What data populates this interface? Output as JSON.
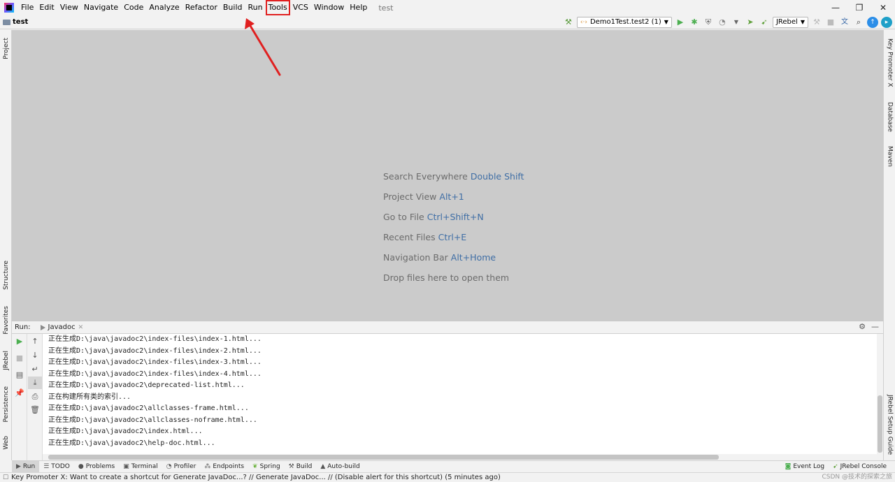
{
  "menu": {
    "items": [
      "File",
      "Edit",
      "View",
      "Navigate",
      "Code",
      "Analyze",
      "Refactor",
      "Build",
      "Run",
      "Tools",
      "VCS",
      "Window",
      "Help"
    ],
    "project_title": "test"
  },
  "window_controls": {
    "minimize": "—",
    "restore": "❐",
    "close": "✕"
  },
  "navbar": {
    "project": "test",
    "run_config": "Demo1Test.test2 (1)",
    "jrebel": "JRebel"
  },
  "left_tabs": [
    "Project",
    "Structure",
    "Favorites",
    "JRebel",
    "Persistence",
    "Web"
  ],
  "right_tabs": [
    "Key Promoter X",
    "Database",
    "Maven",
    "JRebel Setup Guide"
  ],
  "editor_hints": [
    {
      "text": "Search Everywhere",
      "shortcut": "Double Shift"
    },
    {
      "text": "Project View",
      "shortcut": "Alt+1"
    },
    {
      "text": "Go to File",
      "shortcut": "Ctrl+Shift+N"
    },
    {
      "text": "Recent Files",
      "shortcut": "Ctrl+E"
    },
    {
      "text": "Navigation Bar",
      "shortcut": "Alt+Home"
    },
    {
      "text": "Drop files here to open them",
      "shortcut": ""
    }
  ],
  "run_panel": {
    "label": "Run:",
    "tab": "Javadoc",
    "lines": [
      "正在生成D:\\java\\javadoc2\\index-files\\index-1.html...",
      "正在生成D:\\java\\javadoc2\\index-files\\index-2.html...",
      "正在生成D:\\java\\javadoc2\\index-files\\index-3.html...",
      "正在生成D:\\java\\javadoc2\\index-files\\index-4.html...",
      "正在生成D:\\java\\javadoc2\\deprecated-list.html...",
      "正在构建所有类的索引...",
      "正在生成D:\\java\\javadoc2\\allclasses-frame.html...",
      "正在生成D:\\java\\javadoc2\\allclasses-noframe.html...",
      "正在生成D:\\java\\javadoc2\\index.html...",
      "正在生成D:\\java\\javadoc2\\help-doc.html..."
    ]
  },
  "bottom_tabs": [
    "Run",
    "TODO",
    "Problems",
    "Terminal",
    "Profiler",
    "Endpoints",
    "Spring",
    "Build",
    "Auto-build"
  ],
  "bottom_right_tabs": [
    "Event Log",
    "JRebel Console"
  ],
  "status": {
    "message": "Key Promoter X: Want to create a shortcut for Generate JavaDoc...? // Generate JavaDoc... // (Disable alert for this shortcut) (5 minutes ago)",
    "watermark": "CSDN @技术的探索之旅"
  },
  "colors": {
    "highlight": "#e02020",
    "editor_bg": "#cbcbcb",
    "shortcut": "#3f6ea5"
  }
}
